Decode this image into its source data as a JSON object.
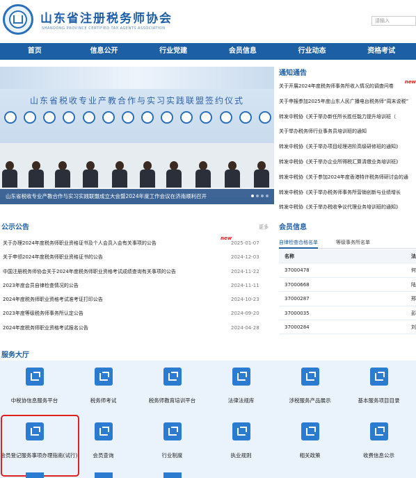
{
  "header": {
    "title": "山东省注册税务师协会",
    "subtitle": "SHANDONG PROVINCE CERTIFIED TAX AGENTS ASSOCIATION",
    "search_placeholder": "请输入"
  },
  "nav": [
    "首页",
    "信息公开",
    "行业党建",
    "会员信息",
    "行业动态",
    "资格考试"
  ],
  "banner": {
    "headline": "山东省税收专业产教合作与实习实践联盟签约仪式",
    "caption": "山东省税收专业产教合作与实习实践联盟成立大会暨2024年度工作会议在济南顺利召开"
  },
  "notices": {
    "title": "通知通告",
    "new_label": "new",
    "items": [
      "关于开展2024年度税务师事务所收入情况的调查问卷",
      "关于申报参加2025年度山东人民广播电台税务师“周末说税”",
      "转发中税协《关于举办新任所长胜任能力提升培训班（",
      "关于举办税务师行业事务员培训班的通知",
      "转发中税协《关于举办项目经理进阶高级研修班的通知》",
      "转发中税协《关于举办企业所得税汇算清缴业务培训班》",
      "转发中税协《关于参加2024年度香港特许税务师研讨会的通",
      "转发中税协《关于举办税务师事务所营销创新与业绩增长",
      "转发中税协《关于举办税收争议代理业务培训班的通知》"
    ]
  },
  "public": {
    "title": "公示公告",
    "more": "更多",
    "new_label": "new",
    "items": [
      {
        "text": "关于办理2024年度税务师职业资格证书及个人会员入会有关事项的公告",
        "date": "2025-01-07"
      },
      {
        "text": "关于申领2024年度税务师职业资格证书的公告",
        "date": "2024-12-03"
      },
      {
        "text": "中国注册税务师协会关于2024年度税务师职业资格考试成绩查询有关事项的公告",
        "date": "2024-11-22"
      },
      {
        "text": "2023年度会员自律检查情况的公告",
        "date": "2024-11-11"
      },
      {
        "text": "2024年度税务师职业资格考试准考证打印公告",
        "date": "2024-10-23"
      },
      {
        "text": "2023年度等级税务师事务所认定公告",
        "date": "2024-09-20"
      },
      {
        "text": "2024年度税务师职业资格考试报名公告",
        "date": "2024-04-28"
      }
    ]
  },
  "members": {
    "title": "会员信息",
    "tabs": [
      "自律检查合格名单",
      "等级事务所名单"
    ],
    "headers": [
      "名称",
      "法"
    ],
    "rows": [
      [
        "37000478",
        "何"
      ],
      [
        "37000668",
        "陆"
      ],
      [
        "37000287",
        "邢"
      ],
      [
        "37000035",
        "彭"
      ],
      [
        "37000284",
        "刘"
      ]
    ]
  },
  "services": {
    "title": "服务大厅",
    "row1": [
      "中税协信息服务平台",
      "税务师考试",
      "税务师教育培训平台",
      "法律法规库",
      "涉税服务产品展示",
      "基本服务项目目录"
    ],
    "row2": [
      "会员登记服务事项办理指南(试行)",
      "会员查询",
      "行业制度",
      "执业规则",
      "相关政策",
      "收费信息公示"
    ]
  }
}
